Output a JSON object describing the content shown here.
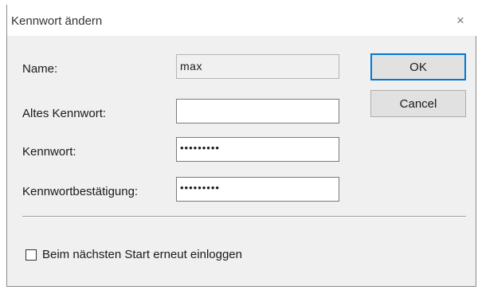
{
  "window": {
    "title": "Kennwort ändern",
    "close_glyph": "×"
  },
  "form": {
    "name_label": "Name:",
    "name_value": "max",
    "old_password_label": "Altes Kennwort:",
    "old_password_value": "",
    "password_label": "Kennwort:",
    "password_value": "•••••••••",
    "confirm_label": "Kennwortbestätigung:",
    "confirm_value": "•••••••••"
  },
  "buttons": {
    "ok_label": "OK",
    "cancel_label": "Cancel"
  },
  "options": {
    "relogin_label": "Beim nächsten Start erneut einloggen",
    "relogin_checked": false
  },
  "colors": {
    "default_button_border": "#0078d7",
    "dialog_background": "#f0f0f0"
  }
}
